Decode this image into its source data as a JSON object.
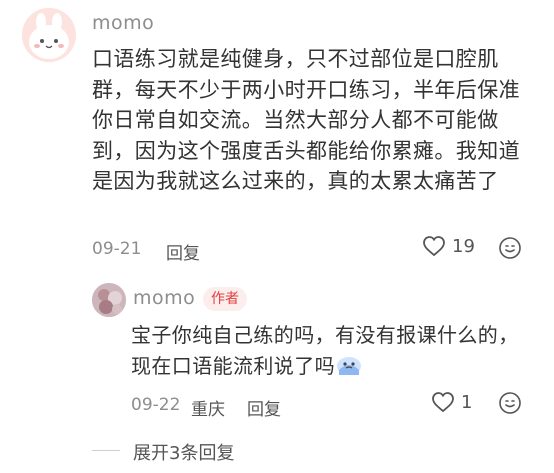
{
  "comment": {
    "username": "momo",
    "text": "口语练习就是纯健身，只不过部位是口腔肌群，每天不少于两小时开口练习，半年后保准你日常自如交流。当然大部分人都不可能做到，因为这个强度舌头都能给你累瘫。我知道是因为我就这么过来的，真的太累太痛苦了",
    "date": "09-21",
    "reply_label": "回复",
    "like_count": "19"
  },
  "reply": {
    "username": "momo",
    "badge": "作者",
    "text": "宝子你纯自己练的吗，有没有报课什么的，现在口语能流利说了吗",
    "date": "09-22",
    "location": "重庆",
    "reply_label": "回复",
    "like_count": "1"
  },
  "expand_label": "展开3条回复"
}
